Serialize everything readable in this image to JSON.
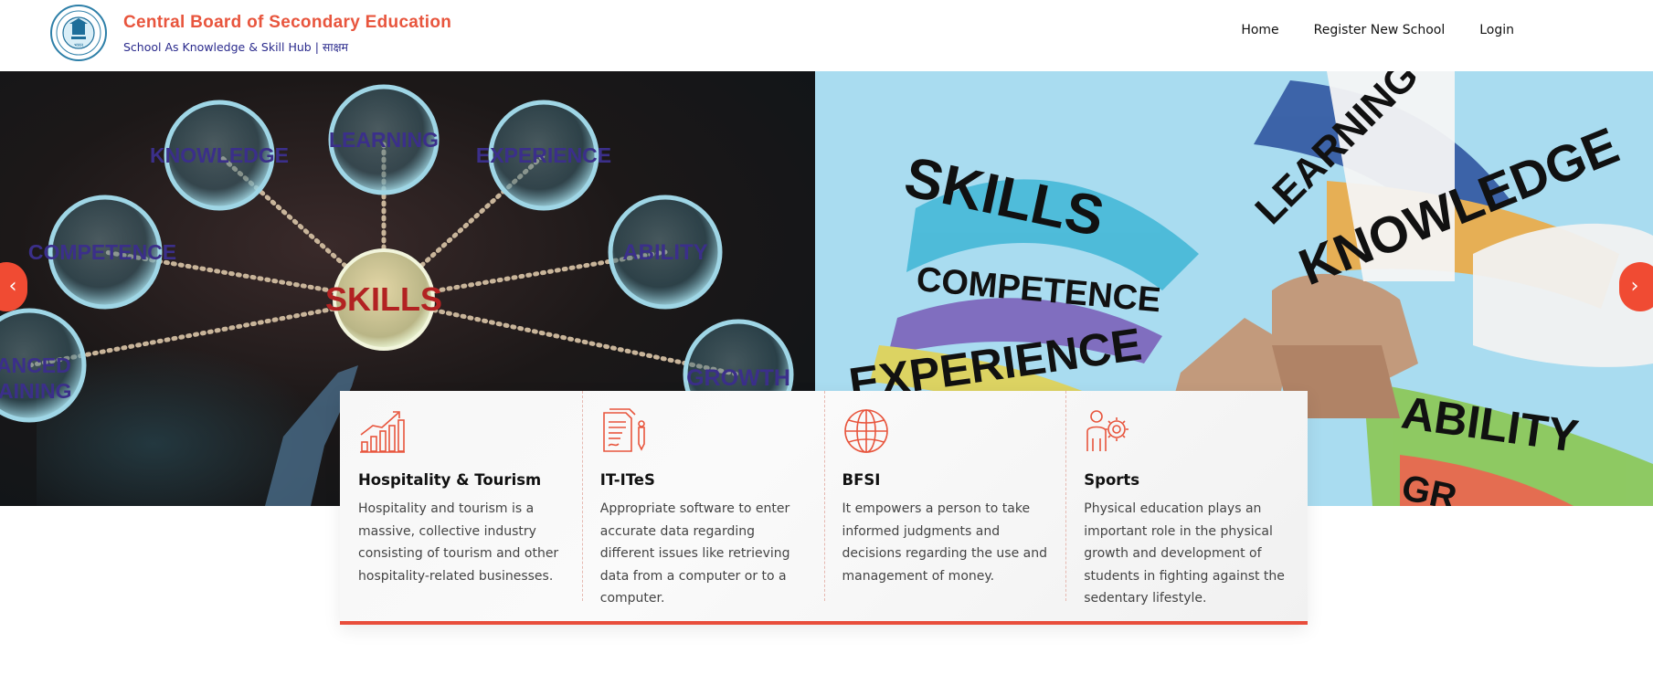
{
  "header": {
    "title": "Central Board of Secondary Education",
    "subtitle": "School As Knowledge & Skill Hub | साक्षम",
    "nav": [
      {
        "label": "Home"
      },
      {
        "label": "Register New School"
      },
      {
        "label": "Login"
      }
    ]
  },
  "hero": {
    "left_words": [
      "KNOWLEDGE",
      "LEARNING",
      "EXPERIENCE",
      "COMPETENCE",
      "ABILITY",
      "SKILLS",
      "VANCED",
      "RAINING",
      "GROWTH"
    ],
    "right_words": [
      "SKILLS",
      "COMPETENCE",
      "EXPERIENCE",
      "LEARNING",
      "KNOWLEDGE",
      "ABILITY",
      "GR"
    ],
    "prev_icon": "chevron-left-icon",
    "next_icon": "chevron-right-icon",
    "accent": "#f04b33"
  },
  "cards": [
    {
      "icon": "bar-chart-growth-icon",
      "title": "Hospitality & Tourism",
      "text": "Hospitality and tourism is a massive, collective industry consisting of tourism and other hospitality-related businesses."
    },
    {
      "icon": "documents-pen-icon",
      "title": "IT-ITeS",
      "text": "Appropriate software to enter accurate data regarding different issues like retrieving data from a computer or to a computer."
    },
    {
      "icon": "globe-icon",
      "title": "BFSI",
      "text": "It empowers a person to take informed judgments and decisions regarding the use and management of money."
    },
    {
      "icon": "person-gear-icon",
      "title": "Sports",
      "text": "Physical education plays an important role in the physical growth and development of students in fighting against the sedentary lifestyle."
    }
  ],
  "colors": {
    "brand_orange": "#e8553d",
    "brand_navy": "#2a2a8c",
    "icon_orange": "#e8553d"
  }
}
